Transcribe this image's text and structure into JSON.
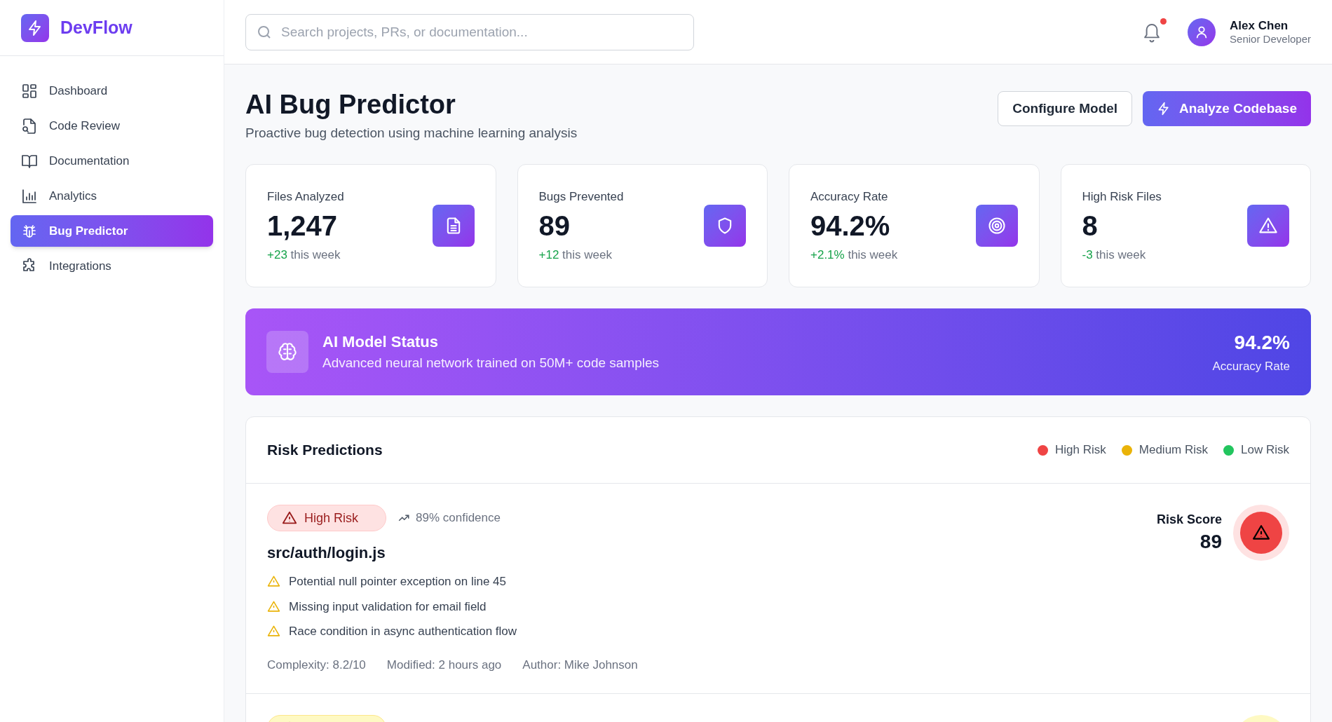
{
  "brand": {
    "name": "DevFlow"
  },
  "sidebar": {
    "items": [
      {
        "label": "Dashboard",
        "selected": false
      },
      {
        "label": "Code Review",
        "selected": false
      },
      {
        "label": "Documentation",
        "selected": false
      },
      {
        "label": "Analytics",
        "selected": false
      },
      {
        "label": "Bug Predictor",
        "selected": true
      },
      {
        "label": "Integrations",
        "selected": false
      }
    ]
  },
  "header": {
    "search": {
      "placeholder": "Search projects, PRs, or documentation..."
    },
    "notifications": {
      "unread": true
    },
    "user": {
      "name": "Alex Chen",
      "role": "Senior Developer"
    }
  },
  "page": {
    "title": "AI Bug Predictor",
    "subtitle": "Proactive bug detection using machine learning analysis",
    "buttons": [
      {
        "label": "Configure Model",
        "kind": "secondary"
      },
      {
        "label": "Analyze Codebase",
        "kind": "primary"
      }
    ]
  },
  "stats": [
    {
      "label": "Files Analyzed",
      "value": "1,247",
      "change": "+23",
      "period": "this week"
    },
    {
      "label": "Bugs Prevented",
      "value": "89",
      "change": "+12",
      "period": "this week"
    },
    {
      "label": "Accuracy Rate",
      "value": "94.2%",
      "change": "+2.1%",
      "period": "this week"
    },
    {
      "label": "High Risk Files",
      "value": "8",
      "change": "-3",
      "period": "this week"
    }
  ],
  "model_status": {
    "title": "AI Model Status",
    "description": "Advanced neural network trained on 50M+ code samples",
    "value": "94.2%",
    "value_label": "Accuracy Rate"
  },
  "risk_predictions": {
    "title": "Risk Predictions",
    "legend": [
      {
        "label": "High Risk",
        "color": "#ef4444"
      },
      {
        "label": "Medium Risk",
        "color": "#eab308"
      },
      {
        "label": "Low Risk",
        "color": "#22c55e"
      }
    ],
    "items": [
      {
        "kind": "high",
        "badge": "High Risk",
        "confidence": "89% confidence",
        "file": "src/auth/login.js",
        "issues": [
          "Potential null pointer exception on line 45",
          "Missing input validation for email field",
          "Race condition in async authentication flow"
        ],
        "meta": [
          "Complexity: 8.2/10",
          "Modified: 2 hours ago",
          "Author: Mike Johnson"
        ],
        "score_label": "Risk Score",
        "score": "89"
      },
      {
        "kind": "medium"
      }
    ]
  }
}
